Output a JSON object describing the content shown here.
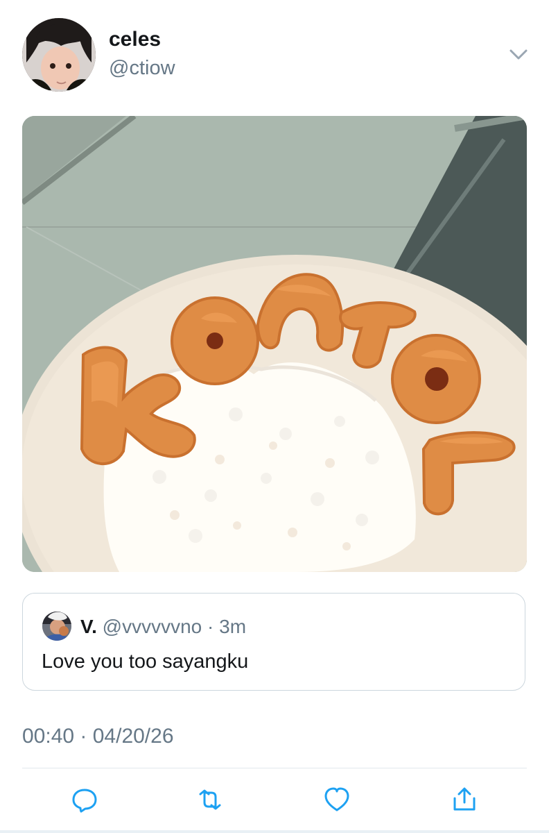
{
  "tweet": {
    "display_name": "celes",
    "handle": "@ctiow",
    "media_text": "KONTOL",
    "timestamp": "00:40 · 04/20/26"
  },
  "quote": {
    "name": "V.",
    "handle": "@vvvvvvno",
    "separator": "·",
    "time": "3m",
    "text": "Love you too sayangku"
  },
  "actions": [
    "reply",
    "retweet",
    "like",
    "share"
  ],
  "colors": {
    "text": "#14171a",
    "secondary": "#657786",
    "action": "#1da1f2",
    "border": "#ccd6dd"
  }
}
